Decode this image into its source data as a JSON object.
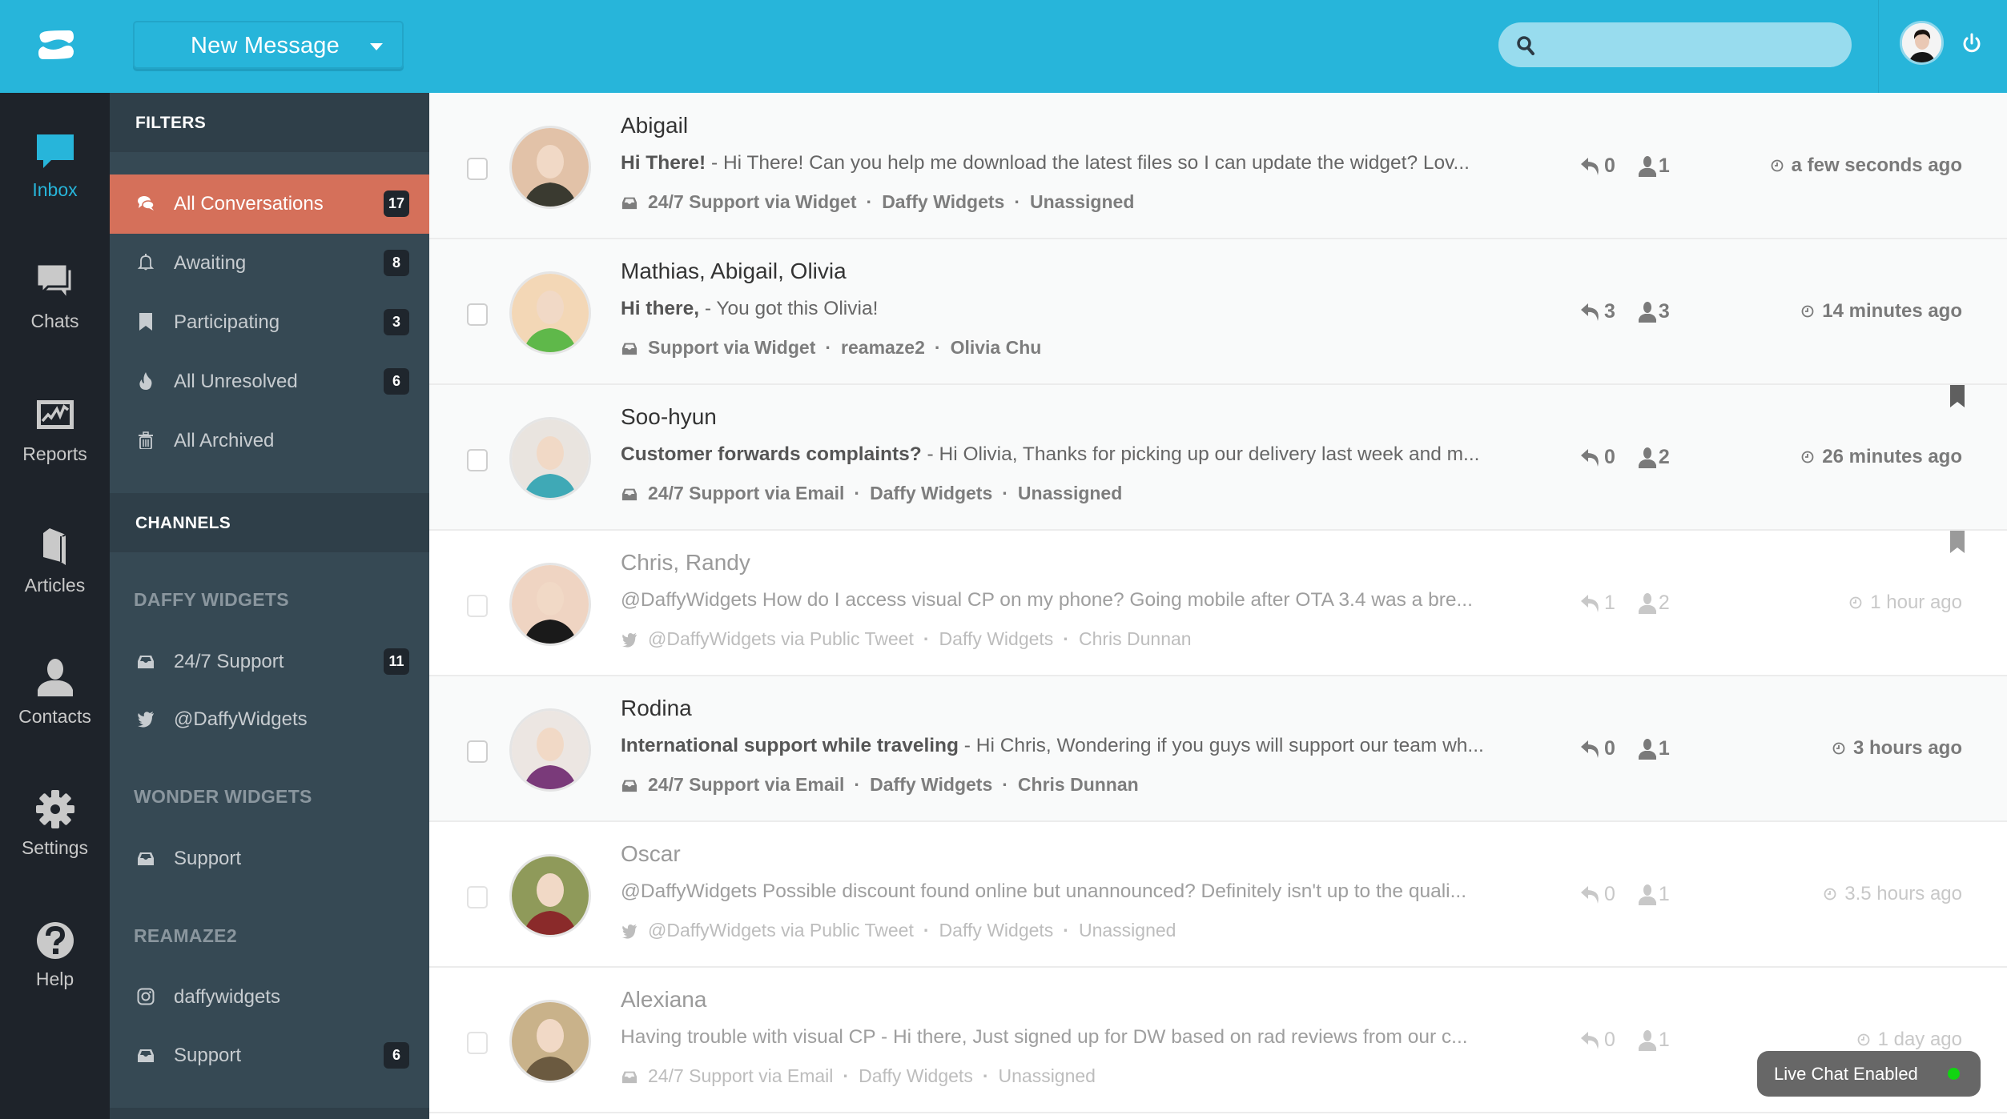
{
  "header": {
    "new_message_label": "New Message",
    "search_placeholder": "",
    "brand_color": "#27b5da"
  },
  "nav": [
    {
      "label": "Inbox",
      "icon": "inbox-icon",
      "active": true
    },
    {
      "label": "Chats",
      "icon": "chats-icon",
      "active": false
    },
    {
      "label": "Reports",
      "icon": "reports-icon",
      "active": false
    },
    {
      "label": "Articles",
      "icon": "articles-icon",
      "active": false
    },
    {
      "label": "Contacts",
      "icon": "contacts-icon",
      "active": false
    },
    {
      "label": "Settings",
      "icon": "settings-icon",
      "active": false
    },
    {
      "label": "Help",
      "icon": "help-icon",
      "active": false
    }
  ],
  "filters": {
    "title": "FILTERS",
    "items": [
      {
        "label": "All Conversations",
        "icon": "conversations-icon",
        "count": "17",
        "active": true
      },
      {
        "label": "Awaiting",
        "icon": "bell-icon",
        "count": "8"
      },
      {
        "label": "Participating",
        "icon": "bookmark-icon",
        "count": "3"
      },
      {
        "label": "All Unresolved",
        "icon": "flame-icon",
        "count": "6"
      },
      {
        "label": "All Archived",
        "icon": "trash-icon",
        "count": null
      }
    ]
  },
  "channels": {
    "title": "CHANNELS",
    "groups": [
      {
        "name": "DAFFY WIDGETS",
        "items": [
          {
            "label": "24/7 Support",
            "icon": "inbox-tray-icon",
            "count": "11"
          },
          {
            "label": "@DaffyWidgets",
            "icon": "twitter-icon",
            "count": null
          }
        ]
      },
      {
        "name": "WONDER WIDGETS",
        "items": [
          {
            "label": "Support",
            "icon": "inbox-tray-icon",
            "count": null
          }
        ]
      },
      {
        "name": "REAMAZE2",
        "items": [
          {
            "label": "daffywidgets",
            "icon": "instagram-icon",
            "count": null
          },
          {
            "label": "Support",
            "icon": "inbox-tray-icon",
            "count": "6"
          }
        ]
      }
    ]
  },
  "conversations": [
    {
      "name": "Abigail",
      "subject": "Hi There!",
      "preview": " - Hi There! Can you help me download the latest files so I can update the widget? Lov...",
      "channel_icon": "inbox-tray-icon",
      "channel": "24/7 Support via Widget",
      "brand": "Daffy Widgets",
      "assignee": "Unassigned",
      "replies": "0",
      "participants": "1",
      "time": "a few seconds ago",
      "unread": true,
      "bookmarked": false,
      "avatar_colors": [
        "#3a3a30",
        "#e2c2a8"
      ]
    },
    {
      "name": "Mathias, Abigail, Olivia",
      "subject": "Hi there,",
      "preview": " - You got this Olivia!",
      "channel_icon": "inbox-tray-icon",
      "channel": "Support via Widget",
      "brand": "reamaze2",
      "assignee": "Olivia Chu",
      "replies": "3",
      "participants": "3",
      "time": "14 minutes ago",
      "unread": true,
      "bookmarked": false,
      "avatar_colors": [
        "#5fb84a",
        "#f3d7b6"
      ]
    },
    {
      "name": "Soo-hyun",
      "subject": "Customer forwards complaints?",
      "preview": " - Hi Olivia, Thanks for picking up our delivery last week and m...",
      "channel_icon": "inbox-tray-icon",
      "channel": "24/7 Support via Email",
      "brand": "Daffy Widgets",
      "assignee": "Unassigned",
      "replies": "0",
      "participants": "2",
      "time": "26 minutes ago",
      "unread": true,
      "bookmarked": true,
      "avatar_colors": [
        "#3fa9b6",
        "#e9e4df"
      ]
    },
    {
      "name": "Chris, Randy",
      "subject": "",
      "preview": "@DaffyWidgets How do I access visual CP on my phone? Going mobile after OTA 3.4 was a bre...",
      "channel_icon": "twitter-icon",
      "channel": "@DaffyWidgets via Public Tweet",
      "brand": "Daffy Widgets",
      "assignee": "Chris Dunnan",
      "replies": "1",
      "participants": "2",
      "time": "1 hour ago",
      "unread": false,
      "bookmarked": true,
      "avatar_colors": [
        "#1a1a1a",
        "#efd4c2"
      ]
    },
    {
      "name": "Rodina",
      "subject": "International support while traveling",
      "preview": " - Hi Chris, Wondering if you guys will support our team wh...",
      "channel_icon": "inbox-tray-icon",
      "channel": "24/7 Support via Email",
      "brand": "Daffy Widgets",
      "assignee": "Chris Dunnan",
      "replies": "0",
      "participants": "1",
      "time": "3 hours ago",
      "unread": true,
      "bookmarked": false,
      "avatar_colors": [
        "#7a3a7a",
        "#ece6e2"
      ]
    },
    {
      "name": "Oscar",
      "subject": "",
      "preview": "@DaffyWidgets Possible discount found online but unannounced? Definitely isn't up to the quali...",
      "channel_icon": "twitter-icon",
      "channel": "@DaffyWidgets via Public Tweet",
      "brand": "Daffy Widgets",
      "assignee": "Unassigned",
      "replies": "0",
      "participants": "1",
      "time": "3.5 hours ago",
      "unread": false,
      "bookmarked": false,
      "avatar_colors": [
        "#8a2a2a",
        "#8f9a5a"
      ]
    },
    {
      "name": "Alexiana",
      "subject": "Having trouble with visual CP",
      "preview": " - Hi there, Just signed up for DW based on rad reviews from our c...",
      "channel_icon": "inbox-tray-icon",
      "channel": "24/7 Support via Email",
      "brand": "Daffy Widgets",
      "assignee": "Unassigned",
      "replies": "0",
      "participants": "1",
      "time": "1 day ago",
      "unread": false,
      "bookmarked": false,
      "avatar_colors": [
        "#6b5a40",
        "#c9b28a"
      ]
    }
  ],
  "live_chat": {
    "label": "Live Chat Enabled",
    "status_color": "#11d511"
  }
}
